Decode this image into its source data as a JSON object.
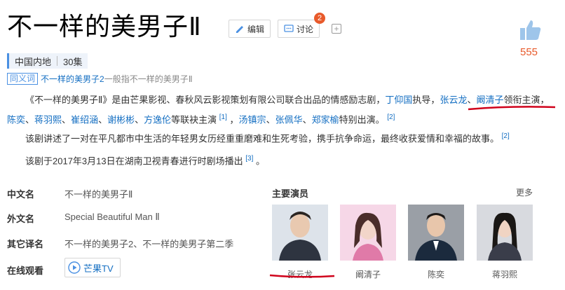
{
  "header": {
    "title": "不一样的美男子Ⅱ",
    "edit_label": "编辑",
    "discuss_label": "讨论",
    "discuss_badge": "2",
    "like_count": "555"
  },
  "tags": [
    "中国内地",
    "30集"
  ],
  "synonym": {
    "label": "同义词",
    "link": "不一样的美男子2",
    "text": "一般指不一样的美男子Ⅱ"
  },
  "para1": {
    "t1": "《不一样的美男子Ⅱ》是由芒果影视、春秋风云影视策划有限公司联合出品的情感励志剧，",
    "l1": "丁仰国",
    "t2": "执导，",
    "l2": "张云龙",
    "t3": "、",
    "l3": "阚清子",
    "t4": "领衔主演，",
    "l4": "陈奕",
    "t5": "、",
    "l5": "蒋羽熙",
    "t6": "、",
    "l6": "崔绍涵",
    "t7": "、",
    "l7": "谢彬彬",
    "t8": "、",
    "l8": "方逸伦",
    "t9": "等联袂主演",
    "s1": "[1]",
    "t10": "，",
    "l9": "汤镇宗",
    "t11": "、",
    "l10": "张佩华",
    "t12": "、",
    "l11": "郑家榆",
    "t13": "特别出演。",
    "s2": "[2]"
  },
  "para2": {
    "text": "该剧讲述了一对在平凡都市中生活的年轻男女历经重重磨难和生死考验，携手抗争命运，最终收获爱情和幸福的故事。",
    "sup": "[2]"
  },
  "para3": {
    "text": "该剧于2017年3月13日在湖南卫视青春进行时剧场播出",
    "sup": "[3]",
    "end": "。"
  },
  "info": [
    {
      "label": "中文名",
      "value": "不一样的美男子Ⅱ"
    },
    {
      "label": "外文名",
      "value": "Special Beautiful Man Ⅱ"
    },
    {
      "label": "其它译名",
      "value": "不一样的美男子2、不一样的美男子第二季"
    },
    {
      "label": "在线观看",
      "value": "芒果TV"
    }
  ],
  "cast": {
    "title": "主要演员",
    "more": "更多",
    "members": [
      "张云龙",
      "阚清子",
      "陈奕",
      "蒋羽熙"
    ]
  },
  "colors": {
    "link": "#136ec2",
    "accent": "#e85a2b",
    "annotation": "#d0021b"
  }
}
